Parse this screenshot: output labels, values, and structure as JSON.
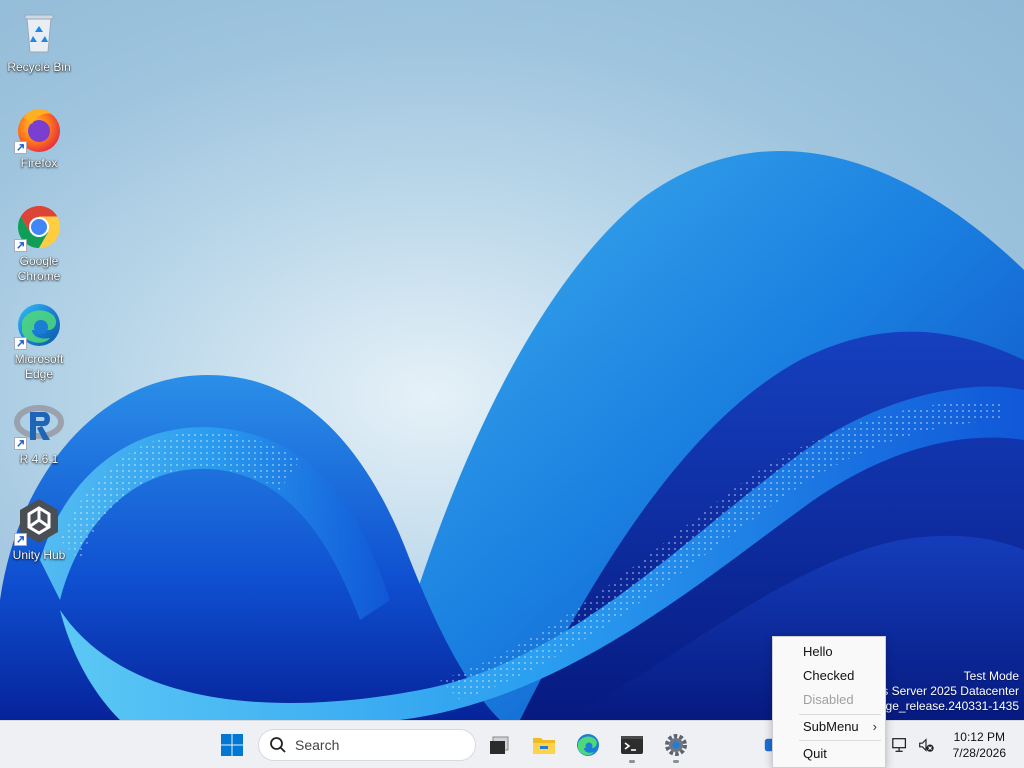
{
  "desktop": {
    "icons": [
      {
        "label": "Recycle Bin",
        "icon": "recycle-bin-icon"
      },
      {
        "label": "Firefox",
        "icon": "firefox-icon"
      },
      {
        "label": "Google Chrome",
        "icon": "chrome-icon"
      },
      {
        "label": "Microsoft Edge",
        "icon": "edge-icon"
      },
      {
        "label": "R 4.6.1",
        "icon": "r-icon"
      },
      {
        "label": "Unity Hub",
        "icon": "unity-hub-icon"
      }
    ],
    "watermark": {
      "line1": "Test Mode",
      "line2": "ws Server 2025 Datacenter",
      "line3": "00.ge_release.240331-1435"
    }
  },
  "taskbar": {
    "search_placeholder": "Search",
    "apps": [
      "start-icon",
      "task-view-icon",
      "file-explorer-icon",
      "edge-icon",
      "terminal-icon",
      "settings-icon"
    ],
    "clock": {
      "time": "10:12 PM",
      "date": "7/28/2026"
    }
  },
  "context_menu": {
    "items": [
      {
        "label": "Hello",
        "enabled": true
      },
      {
        "label": "Checked",
        "enabled": true
      },
      {
        "label": "Disabled",
        "enabled": false
      },
      {
        "label": "SubMenu",
        "enabled": true,
        "submenu": true,
        "arrow": "›"
      },
      {
        "label": "Quit",
        "enabled": true
      }
    ]
  },
  "colors": {
    "taskbar_bg": "#eef0f4",
    "accent": "#0078d4",
    "wallpaper_deep": "#0a2a9a"
  }
}
